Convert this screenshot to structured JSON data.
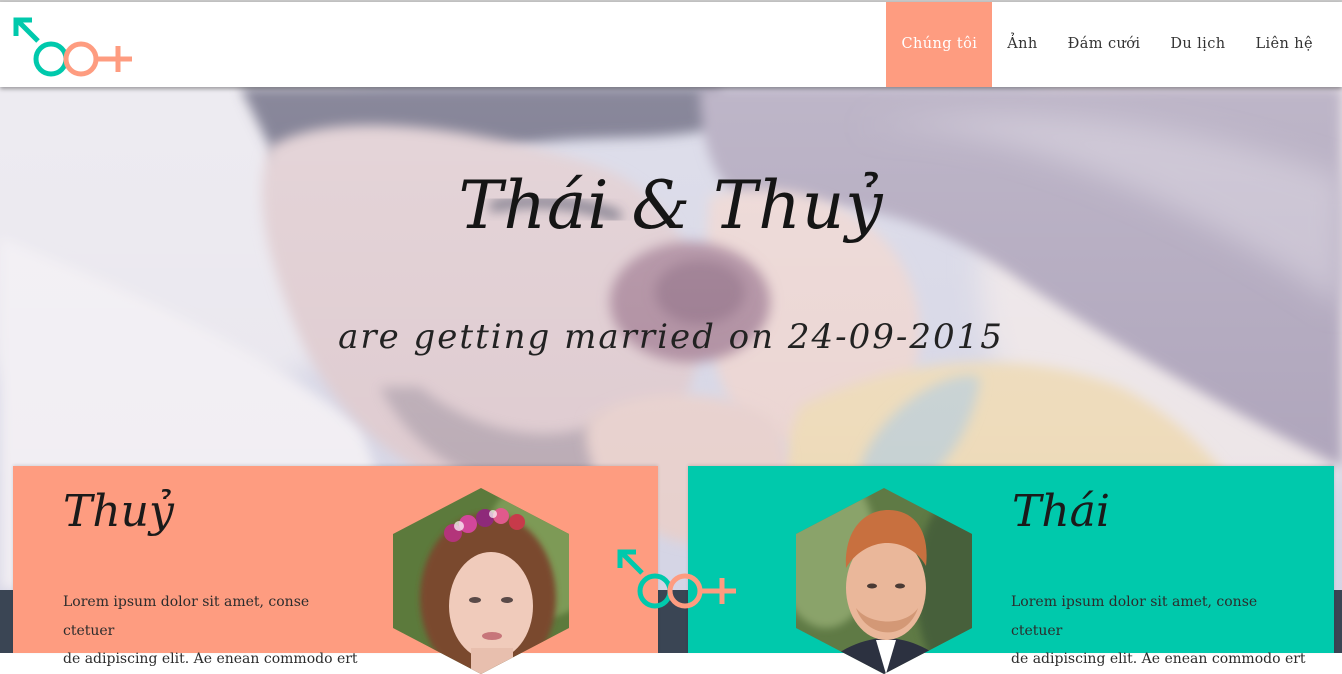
{
  "brand": {
    "logo": "male-female-symbols-logo",
    "colors": {
      "coral": "#fe9c80",
      "teal": "#00c9ac",
      "dark": "#3a4554"
    }
  },
  "nav": {
    "items": [
      {
        "label": "Chúng tôi",
        "active": true
      },
      {
        "label": "Ảnh",
        "active": false
      },
      {
        "label": "Đám cưới",
        "active": false
      },
      {
        "label": "Du lịch",
        "active": false
      },
      {
        "label": "Liên hệ",
        "active": false
      }
    ]
  },
  "hero": {
    "title": "Thái & Thuỷ",
    "subtitle": "are getting married on 24-09-2015",
    "image": "couple-with-rose-photo"
  },
  "bride": {
    "name": "Thuỷ",
    "text_lines": [
      "Lorem ipsum dolor sit amet, conse ctetuer",
      "de adipiscing elit. Ae enean commodo ert"
    ],
    "photo": "bride-portrait-hexagon"
  },
  "groom": {
    "name": "Thái",
    "text_lines": [
      "Lorem ipsum dolor sit amet, conse ctetuer",
      "de adipiscing elit. Ae enean commodo ert"
    ],
    "photo": "groom-portrait-hexagon"
  }
}
